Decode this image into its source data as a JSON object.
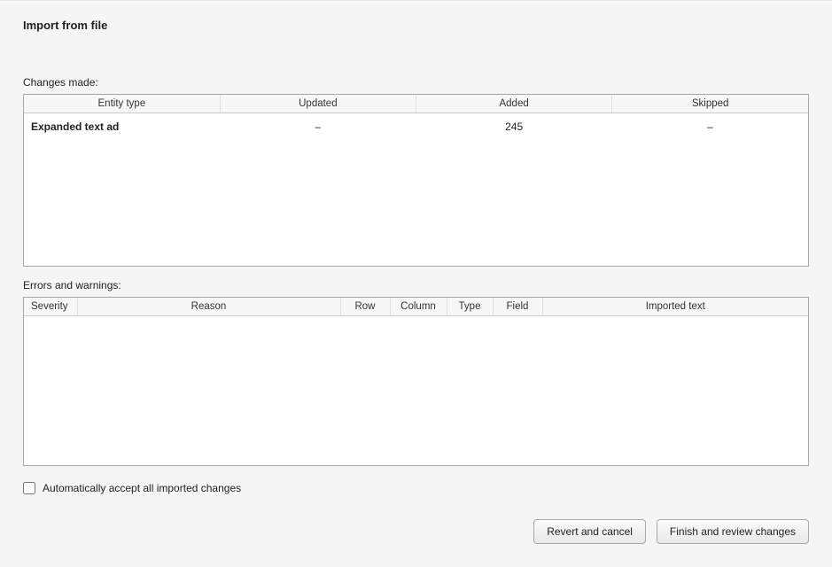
{
  "title": "Import from file",
  "changes": {
    "label": "Changes made:",
    "headers": {
      "entity_type": "Entity type",
      "updated": "Updated",
      "added": "Added",
      "skipped": "Skipped"
    },
    "rows": [
      {
        "entity_type": "Expanded text ad",
        "updated": "–",
        "added": "245",
        "skipped": "–"
      }
    ]
  },
  "errors": {
    "label": "Errors and warnings:",
    "headers": {
      "severity": "Severity",
      "reason": "Reason",
      "row": "Row",
      "column": "Column",
      "type": "Type",
      "field": "Field",
      "imported_text": "Imported text"
    },
    "rows": []
  },
  "checkbox": {
    "label": "Automatically accept all imported changes",
    "checked": false
  },
  "buttons": {
    "revert": "Revert and cancel",
    "finish": "Finish and review changes"
  }
}
